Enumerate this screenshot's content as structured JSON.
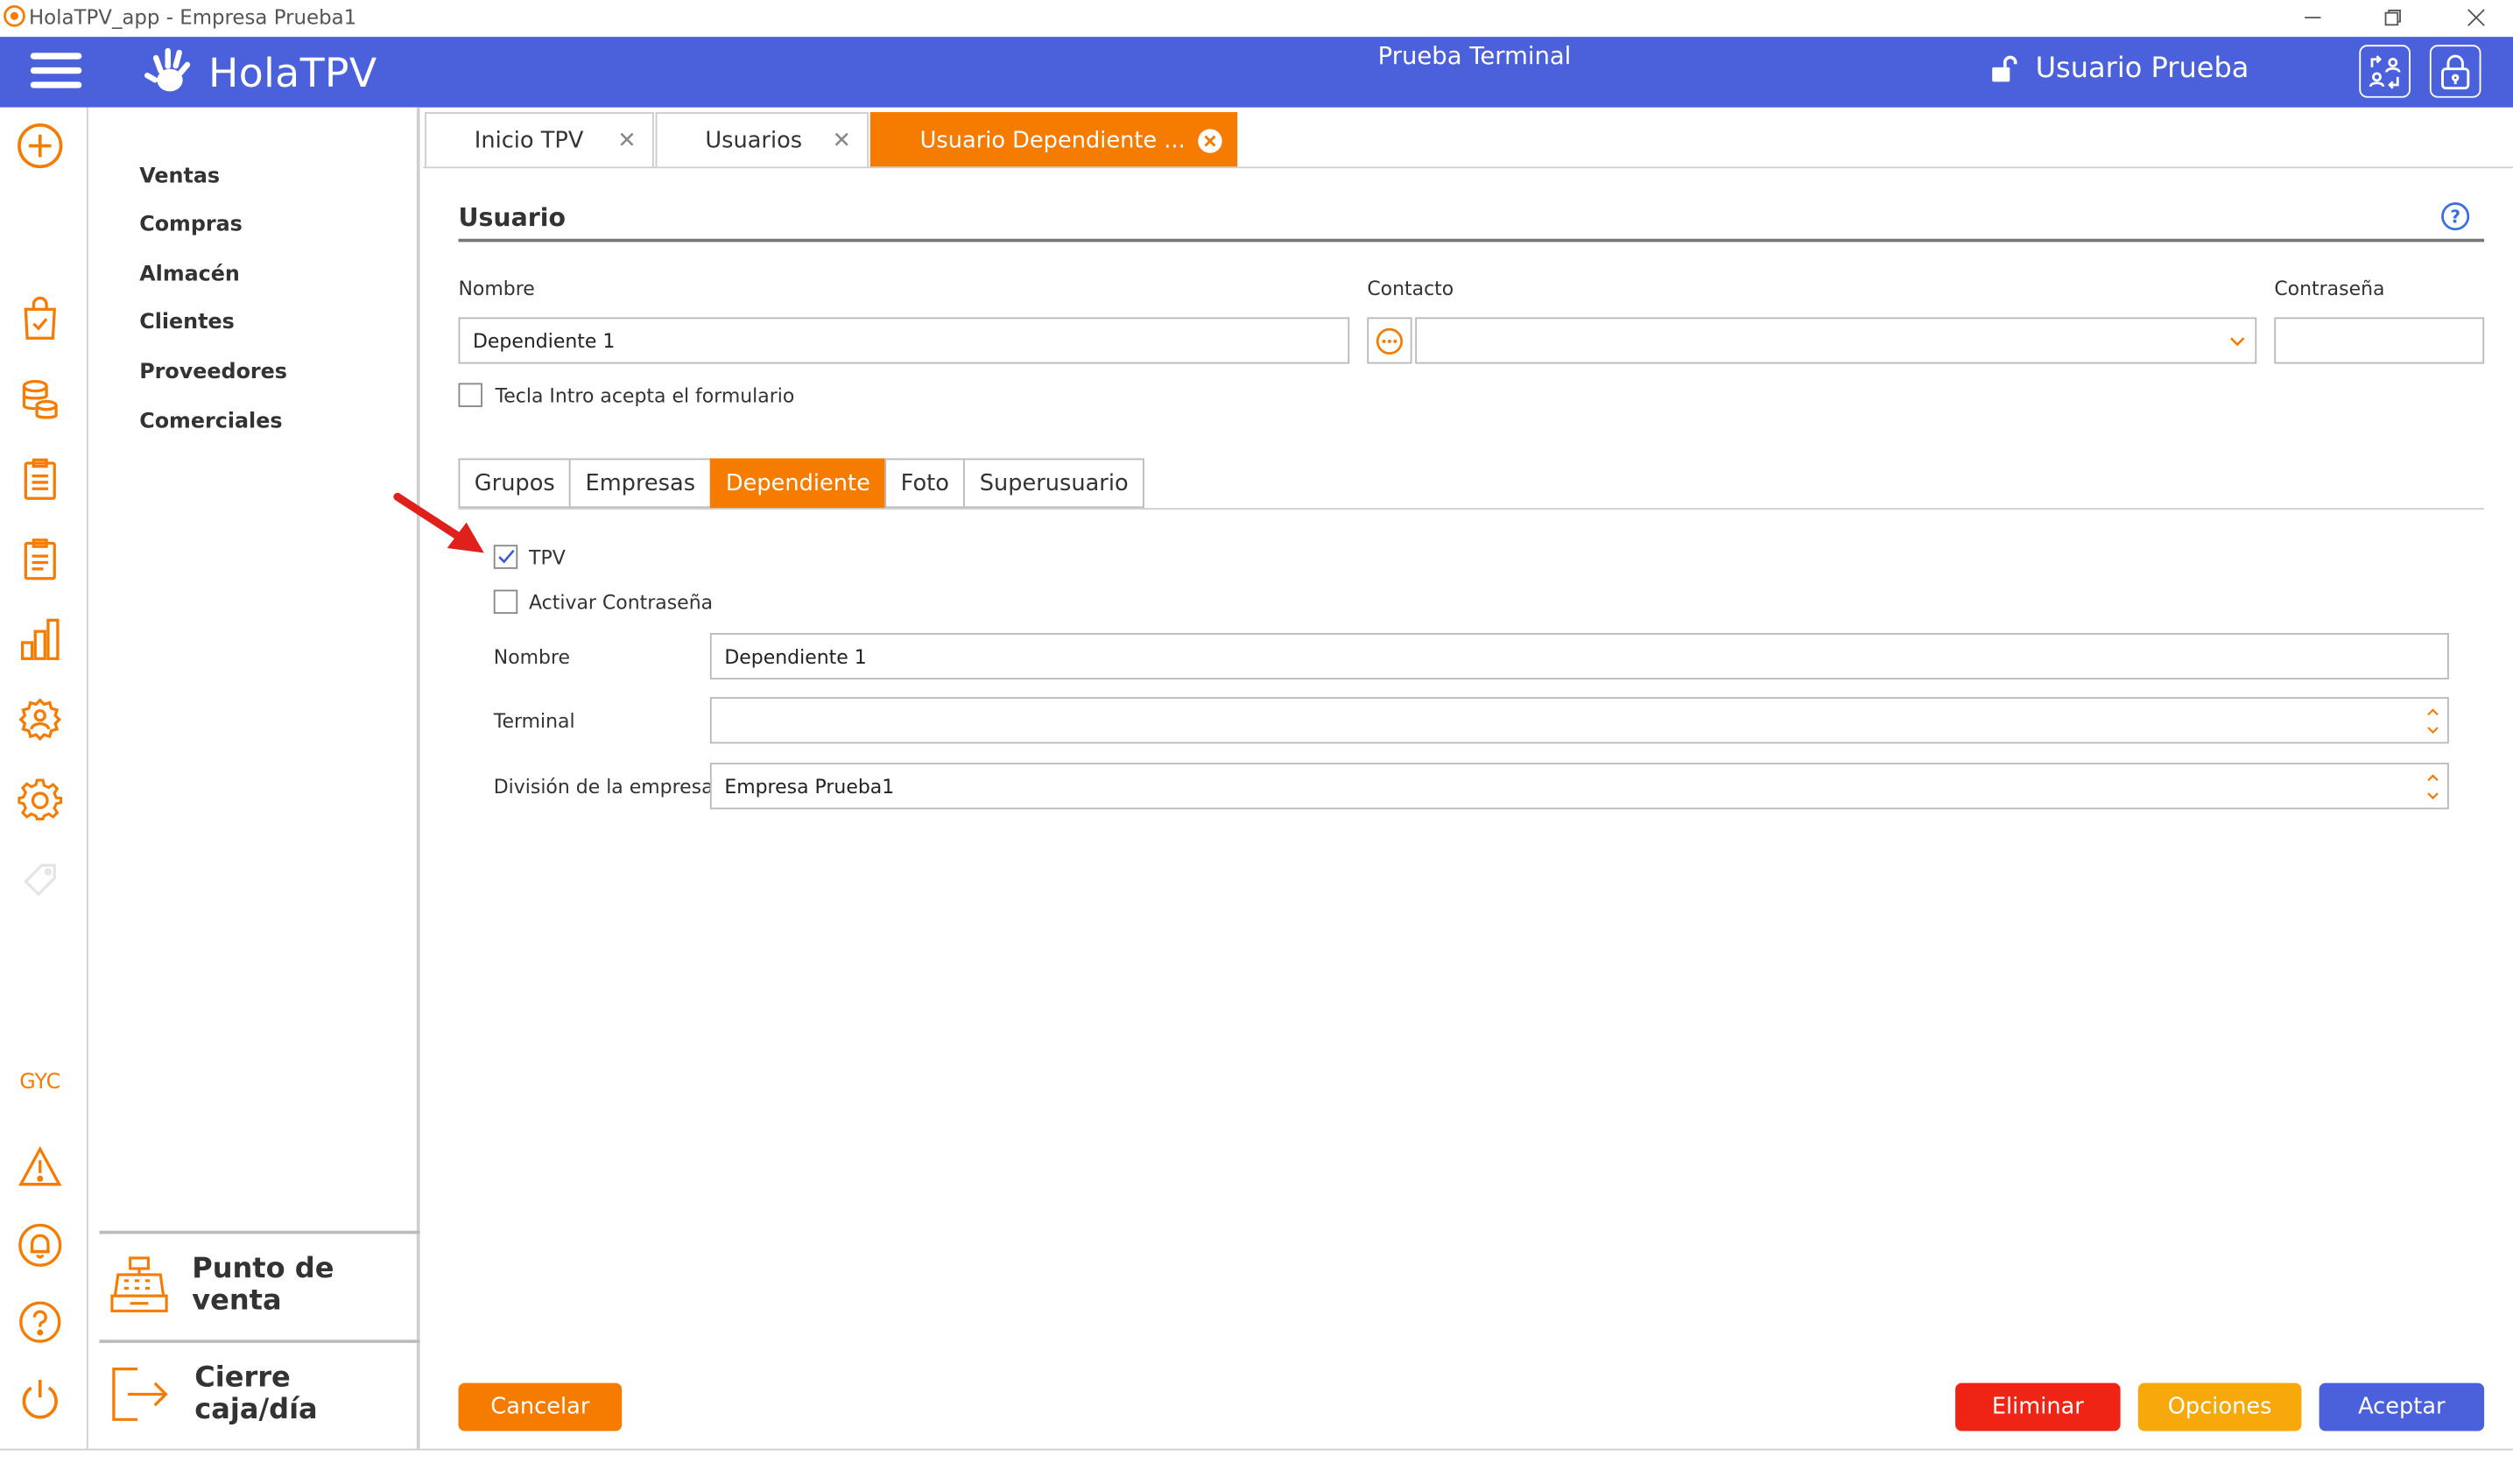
{
  "window": {
    "title": "HolaTPV_app - Empresa Prueba1"
  },
  "header": {
    "brand": "HolaTPV",
    "terminal": "Prueba Terminal",
    "user": "Usuario Prueba",
    "bg_color": "#4b61dc"
  },
  "rail": {
    "gyc_label": "GYC"
  },
  "sidemenu": {
    "items": [
      "Ventas",
      "Compras",
      "Almacén",
      "Clientes",
      "Proveedores",
      "Comerciales"
    ],
    "punto_venta": "Punto de venta",
    "cierre_caja": "Cierre caja/día"
  },
  "tabs": [
    {
      "label": "Inicio TPV",
      "active": false
    },
    {
      "label": "Usuarios",
      "active": false
    },
    {
      "label": "Usuario Dependiente ...",
      "active": true
    }
  ],
  "form": {
    "section_title": "Usuario",
    "nombre_label": "Nombre",
    "nombre_value": "Dependiente 1",
    "contacto_label": "Contacto",
    "contacto_value": "",
    "contrasena_label": "Contraseña",
    "contrasena_value": "",
    "tecla_intro_label": "Tecla Intro acepta el formulario",
    "tecla_intro_checked": false
  },
  "inner_tabs": [
    "Grupos",
    "Empresas",
    "Dependiente",
    "Foto",
    "Superusuario"
  ],
  "inner_tab_active": "Dependiente",
  "dependiente": {
    "tpv_label": "TPV",
    "tpv_checked": true,
    "activar_label": "Activar Contraseña",
    "activar_checked": false,
    "nombre_label": "Nombre",
    "nombre_value": "Dependiente 1",
    "terminal_label": "Terminal",
    "terminal_value": "",
    "division_label": "División de la empresa",
    "division_value": "Empresa Prueba1"
  },
  "buttons": {
    "cancelar": "Cancelar",
    "eliminar": "Eliminar",
    "opciones": "Opciones",
    "aceptar": "Aceptar"
  },
  "colors": {
    "accent": "#f57c00",
    "danger": "#f02414",
    "warning": "#f7a80a",
    "primary": "#4b61dc"
  }
}
